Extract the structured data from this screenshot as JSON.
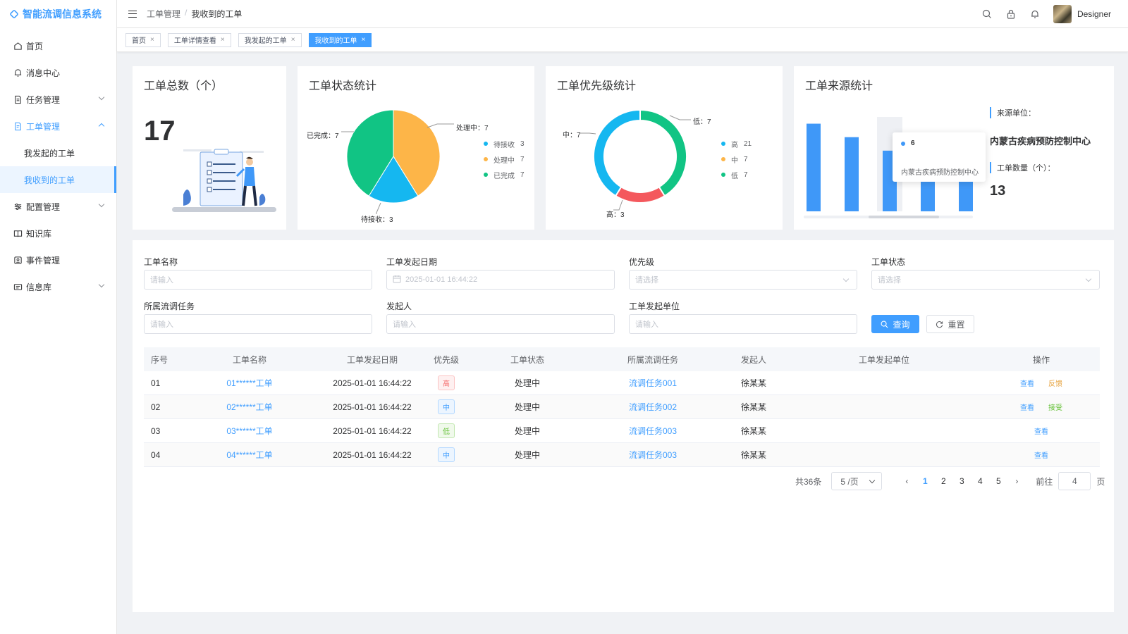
{
  "app": {
    "title": "智能流调信息系统"
  },
  "sidebar": {
    "items": [
      {
        "label": "首页"
      },
      {
        "label": "消息中心"
      },
      {
        "label": "任务管理"
      },
      {
        "label": "工单管理"
      },
      {
        "label": "配置管理"
      },
      {
        "label": "知识库"
      },
      {
        "label": "事件管理"
      },
      {
        "label": "信息库"
      }
    ],
    "sub_items": [
      {
        "label": "我发起的工单"
      },
      {
        "label": "我收到的工单"
      }
    ]
  },
  "header": {
    "breadcrumb": [
      "工单管理",
      "我收到的工单"
    ],
    "breadcrumb_sep": "/",
    "username": "Designer"
  },
  "tabs": [
    {
      "label": "首页",
      "active": false
    },
    {
      "label": "工单详情查看",
      "active": false
    },
    {
      "label": "我发起的工单",
      "active": false
    },
    {
      "label": "我收到的工单",
      "active": true
    }
  ],
  "cards": {
    "total": {
      "title": "工单总数（个）",
      "value": "17"
    },
    "status": {
      "title": "工单状态统计"
    },
    "priority": {
      "title": "工单优先级统计"
    },
    "source": {
      "title": "工单来源统计",
      "unit_label": "来源单位：",
      "unit_value": "内蒙古疾病预防控制中心",
      "count_label": "工单数量（个）：",
      "count_value": "13",
      "tooltip_value": "6",
      "tooltip_name": "内蒙古疾病预防控制中心"
    }
  },
  "chart_data": [
    {
      "type": "pie",
      "title": "工单状态统计",
      "slices": [
        {
          "name": "待接收",
          "value": 3,
          "color": "#15b7f0",
          "label": "待接收：3"
        },
        {
          "name": "处理中",
          "value": 7,
          "color": "#fdb548",
          "label": "处理中：7"
        },
        {
          "name": "已完成",
          "value": 7,
          "color": "#11c484",
          "label": "已完成：7"
        }
      ],
      "legend": [
        {
          "name": "待接收",
          "value": "3"
        },
        {
          "name": "处理中",
          "value": "7"
        },
        {
          "name": "已完成",
          "value": "7"
        }
      ]
    },
    {
      "type": "pie",
      "title": "工单优先级统计",
      "donut": true,
      "slices": [
        {
          "name": "低",
          "value": 7,
          "color": "#11c484",
          "label": "低：7"
        },
        {
          "name": "高",
          "value": 3,
          "color": "#f4585d",
          "label": "高：3"
        },
        {
          "name": "中",
          "value": 7,
          "color": "#15b7f0",
          "label": "中：7"
        }
      ],
      "legend": [
        {
          "name": "高",
          "value": "21",
          "color": "#15b7f0"
        },
        {
          "name": "中",
          "value": "7",
          "color": "#fdb548"
        },
        {
          "name": "低",
          "value": "7",
          "color": "#11c484"
        }
      ]
    },
    {
      "type": "bar",
      "title": "工单来源统计",
      "values": [
        13,
        11,
        9,
        7.5,
        7.5
      ],
      "highlight_index": 2,
      "color": "#3f98f8",
      "ylim": [
        0,
        14
      ]
    }
  ],
  "filters": {
    "name_label": "工单名称",
    "name_placeholder": "请输入",
    "date_label": "工单发起日期",
    "date_placeholder": "2025-01-01 16:44:22",
    "priority_label": "优先级",
    "priority_placeholder": "请选择",
    "status_label": "工单状态",
    "status_placeholder": "请选择",
    "task_label": "所属流调任务",
    "task_placeholder": "请输入",
    "initiator_label": "发起人",
    "initiator_placeholder": "请输入",
    "unit_label": "工单发起单位",
    "unit_placeholder": "请输入",
    "query_label": "查询",
    "reset_label": "重置"
  },
  "table": {
    "headers": [
      "序号",
      "工单名称",
      "工单发起日期",
      "优先级",
      "工单状态",
      "所属流调任务",
      "发起人",
      "工单发起单位",
      "操作"
    ],
    "rows": [
      {
        "no": "01",
        "name": "01******工单",
        "date": "2025-01-01 16:44:22",
        "priority": "高",
        "status": "处理中",
        "task": "流调任务001",
        "initiator": "徐某某",
        "unit": "",
        "ops": [
          "查看",
          "反馈"
        ]
      },
      {
        "no": "02",
        "name": "02******工单",
        "date": "2025-01-01 16:44:22",
        "priority": "中",
        "status": "处理中",
        "task": "流调任务002",
        "initiator": "徐某某",
        "unit": "",
        "ops": [
          "查看",
          "接受"
        ]
      },
      {
        "no": "03",
        "name": "03******工单",
        "date": "2025-01-01 16:44:22",
        "priority": "低",
        "status": "处理中",
        "task": "流调任务003",
        "initiator": "徐某某",
        "unit": "",
        "ops": [
          "查看"
        ]
      },
      {
        "no": "04",
        "name": "04******工单",
        "date": "2025-01-01 16:44:22",
        "priority": "中",
        "status": "处理中",
        "task": "流调任务003",
        "initiator": "徐某某",
        "unit": "",
        "ops": [
          "查看"
        ]
      }
    ]
  },
  "pagination": {
    "total": "共36条",
    "page_size": "5 /页",
    "pages": [
      "1",
      "2",
      "3",
      "4",
      "5"
    ],
    "current": "1",
    "goto_label": "前往",
    "goto_value": "4",
    "page_suffix": "页"
  },
  "colors": {
    "primary": "#409eff",
    "priority_high": "#f56c6c",
    "priority_mid": "#409eff",
    "priority_low": "#67c23a",
    "op_feedback": "#e6a23c",
    "op_accept": "#67c23a"
  }
}
